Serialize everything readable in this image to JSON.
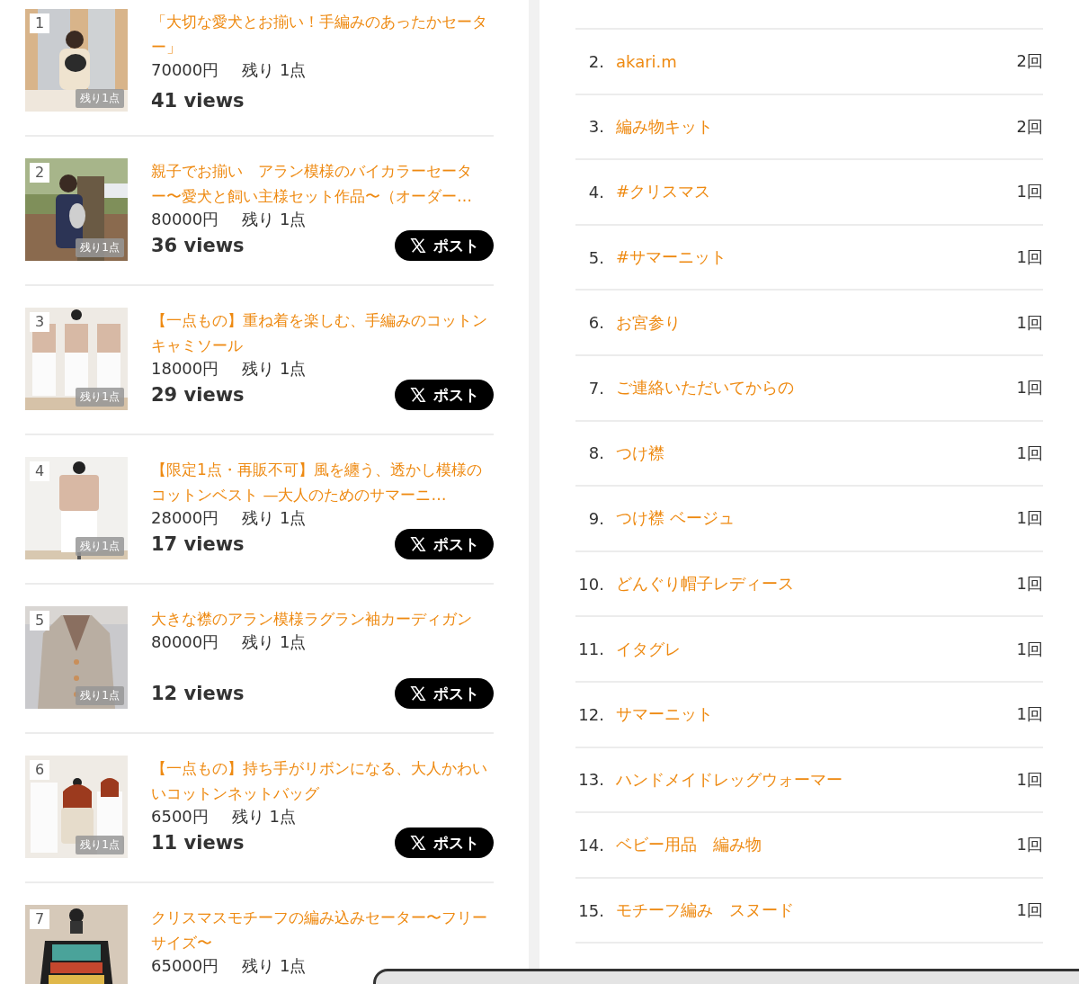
{
  "items": [
    {
      "rank": "1",
      "badge": "残り1点",
      "title": "「大切な愛犬とお揃い！手編みのあったかセーター」",
      "price": "70000円",
      "stock": "残り 1点",
      "views": "41 views"
    },
    {
      "rank": "2",
      "badge": "残り1点",
      "title": "親子でお揃い　アラン模様のバイカラーセーター〜愛犬と飼い主様セット作品〜（オーダー…",
      "price": "80000円",
      "stock": "残り 1点",
      "views": "36 views",
      "post_button": {
        "label": "ポスト"
      }
    },
    {
      "rank": "3",
      "badge": "残り1点",
      "title": "【一点もの】重ね着を楽しむ、手編みのコットンキャミソール",
      "price": "18000円",
      "stock": "残り 1点",
      "views": "29 views",
      "post_button": {
        "label": "ポスト"
      }
    },
    {
      "rank": "4",
      "badge": "残り1点",
      "title": "【限定1点・再販不可】風を纏う、透かし模様のコットンベスト —大人のためのサマーニ…",
      "price": "28000円",
      "stock": "残り 1点",
      "views": "17 views",
      "post_button": {
        "label": "ポスト"
      }
    },
    {
      "rank": "5",
      "badge": "残り1点",
      "title": "大きな襟のアラン模様ラグラン袖カーディガン",
      "price": "80000円",
      "stock": "残り 1点",
      "views": "12 views",
      "post_button": {
        "label": "ポスト"
      }
    },
    {
      "rank": "6",
      "badge": "残り1点",
      "title": "【一点もの】持ち手がリボンになる、大人かわいいコットンネットバッグ",
      "price": "6500円",
      "stock": "残り 1点",
      "views": "11 views",
      "post_button": {
        "label": "ポスト"
      }
    },
    {
      "rank": "7",
      "title": "クリスマスモチーフの編み込みセーター〜フリーサイズ〜",
      "price": "65000円",
      "stock": "残り 1点"
    }
  ],
  "keywords": [
    {
      "rank": "2.",
      "label": "akari.m",
      "count": "2回"
    },
    {
      "rank": "3.",
      "label": "編み物キット",
      "count": "2回"
    },
    {
      "rank": "4.",
      "label": "#クリスマス",
      "count": "1回"
    },
    {
      "rank": "5.",
      "label": "#サマーニット",
      "count": "1回"
    },
    {
      "rank": "6.",
      "label": "お宮参り",
      "count": "1回"
    },
    {
      "rank": "7.",
      "label": "ご連絡いただいてからの",
      "count": "1回"
    },
    {
      "rank": "8.",
      "label": "つけ襟",
      "count": "1回"
    },
    {
      "rank": "9.",
      "label": "つけ襟 ベージュ",
      "count": "1回"
    },
    {
      "rank": "10.",
      "label": "どんぐり帽子レディース",
      "count": "1回"
    },
    {
      "rank": "11.",
      "label": "イタグレ",
      "count": "1回"
    },
    {
      "rank": "12.",
      "label": "サマーニット",
      "count": "1回"
    },
    {
      "rank": "13.",
      "label": "ハンドメイドレッグウォーマー",
      "count": "1回"
    },
    {
      "rank": "14.",
      "label": "ベビー用品　編み物",
      "count": "1回"
    },
    {
      "rank": "15.",
      "label": "モチーフ編み　スヌード",
      "count": "1回"
    }
  ]
}
